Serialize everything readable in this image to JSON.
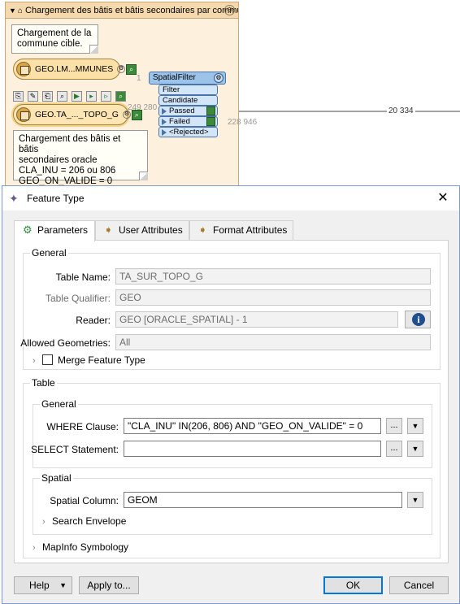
{
  "workbench": {
    "bookmark_title": "Chargement des bâtis et bâtis secondaires par commune",
    "note_top": [
      "Chargement de la",
      "commune cible."
    ],
    "reader1_label": "GEO.LM...MMUNES",
    "reader2_label": "GEO.TA_..._TOPO_G",
    "note_bottom": [
      "Chargement des bâtis et bâtis",
      "secondaires oracle",
      "CLA_INU = 206 ou 806",
      "GEO_ON_VALIDE = 0"
    ],
    "transformer_name": "SpatialFilter",
    "ports": {
      "filter": "Filter",
      "candidate": "Candidate",
      "passed": "Passed",
      "failed": "Failed",
      "rejected": "<Rejected>"
    },
    "counts": {
      "filter_in": "1",
      "candidate_in": "249 280",
      "failed_out": "228 946",
      "passed_out": "20 334"
    }
  },
  "dialog": {
    "title": "Feature Type",
    "close_glyph": "✕",
    "tabs": [
      {
        "label": "Parameters",
        "icon": "gear-icon",
        "active": true
      },
      {
        "label": "User Attributes",
        "icon": "arrow-right-icon",
        "active": false
      },
      {
        "label": "Format Attributes",
        "icon": "arrow-right-icon",
        "active": false
      }
    ],
    "general": {
      "title": "General",
      "table_name_label": "Table Name:",
      "table_name": "TA_SUR_TOPO_G",
      "table_qualifier_label": "Table Qualifier:",
      "table_qualifier": "GEO",
      "reader_label": "Reader:",
      "reader": "GEO [ORACLE_SPATIAL] - 1",
      "allowed_geometries_label": "Allowed Geometries:",
      "allowed_geometries": "All",
      "merge_feature_type_label": "Merge Feature Type",
      "merge_feature_type_checked": false
    },
    "table": {
      "title": "Table",
      "general_title": "General",
      "where_label": "WHERE Clause:",
      "where_value": "\"CLA_INU\" IN(206, 806) AND \"GEO_ON_VALIDE\" = 0",
      "select_label": "SELECT Statement:",
      "select_value": "",
      "ellipsis": "...",
      "spatial_title": "Spatial",
      "spatial_column_label": "Spatial Column:",
      "spatial_column_value": "GEOM",
      "search_envelope_label": "Search Envelope"
    },
    "mapinfo_label": "MapInfo Symbology",
    "buttons": {
      "help": "Help",
      "apply": "Apply to...",
      "ok": "OK",
      "cancel": "Cancel"
    }
  }
}
